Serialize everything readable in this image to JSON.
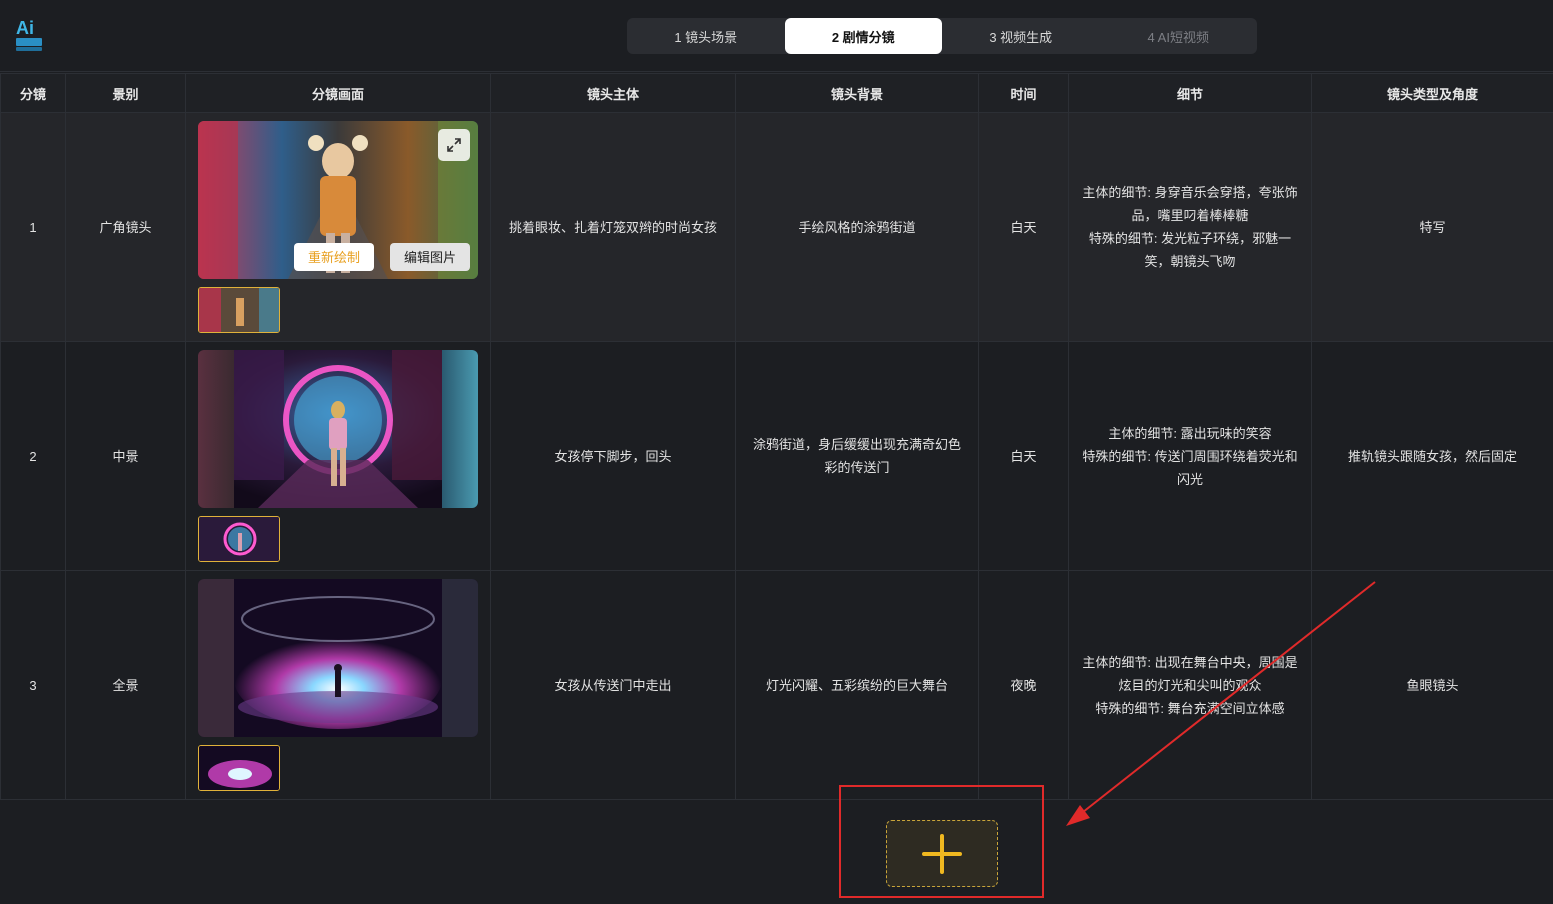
{
  "steps": [
    {
      "label": "1 镜头场景",
      "state": "normal"
    },
    {
      "label": "2 剧情分镜",
      "state": "active"
    },
    {
      "label": "3 视频生成",
      "state": "normal"
    },
    {
      "label": "4 AI短视频",
      "state": "disabled"
    }
  ],
  "table": {
    "headers": [
      "分镜",
      "景别",
      "分镜画面",
      "镜头主体",
      "镜头背景",
      "时间",
      "细节",
      "镜头类型及角度"
    ],
    "rows": [
      {
        "index": "1",
        "shot_size": "广角镜头",
        "subject": "挑着眼妆、扎着灯笼双辫的时尚女孩",
        "background": "手绘风格的涂鸦街道",
        "time": "白天",
        "details": [
          "主体的细节: 身穿音乐会穿搭，夸张饰品，嘴里叼着棒棒糖",
          "特殊的细节: 发光粒子环绕，邪魅一笑，朝镜头飞吻"
        ],
        "camera": "特写"
      },
      {
        "index": "2",
        "shot_size": "中景",
        "subject": "女孩停下脚步，回头",
        "background": "涂鸦街道，身后缓缓出现充满奇幻色彩的传送门",
        "time": "白天",
        "details": [
          "主体的细节: 露出玩味的笑容",
          "特殊的细节: 传送门周围环绕着荧光和闪光"
        ],
        "camera": "推轨镜头跟随女孩，然后固定"
      },
      {
        "index": "3",
        "shot_size": "全景",
        "subject": "女孩从传送门中走出",
        "background": "灯光闪耀、五彩缤纷的巨大舞台",
        "time": "夜晚",
        "details": [
          "主体的细节: 出现在舞台中央，周围是炫目的灯光和尖叫的观众",
          "特殊的细节: 舞台充满空间立体感"
        ],
        "camera": "鱼眼镜头"
      }
    ]
  },
  "image_actions": {
    "redraw": "重新绘制",
    "edit": "编辑图片"
  },
  "colors": {
    "accent": "#e8a020",
    "annotation": "#e02a2a",
    "background": "#1c1e22"
  },
  "icons": {
    "expand": "expand-icon",
    "add": "plus-icon"
  }
}
